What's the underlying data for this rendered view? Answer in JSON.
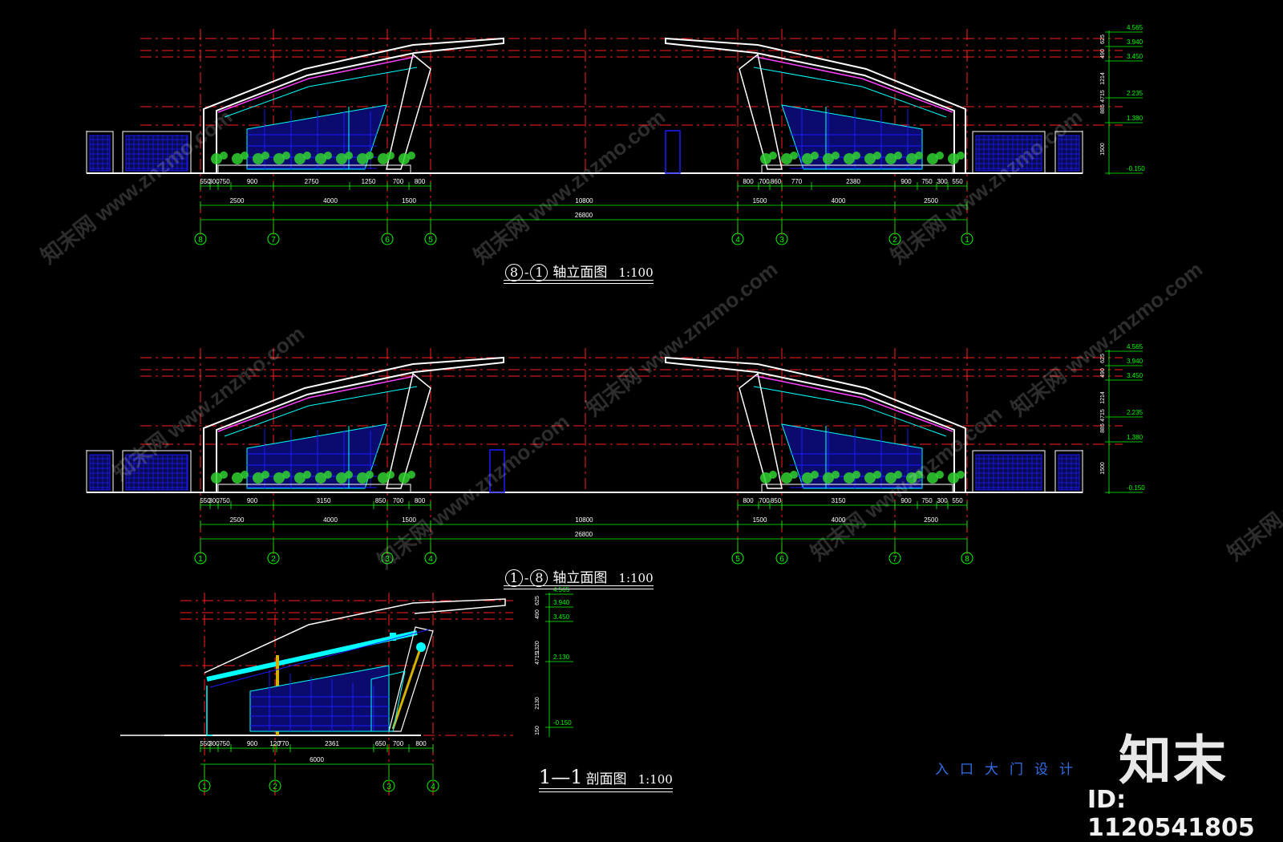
{
  "drawing": {
    "elev1": {
      "title_from": "8",
      "title_sep": "-",
      "title_to": "1",
      "title_name": "轴立面图",
      "scale": "1:100",
      "dims_row1_left": [
        "550",
        "300",
        "750",
        "900",
        "2750",
        "1250",
        "700",
        "800"
      ],
      "dims_row1_right": [
        "800",
        "700",
        "860",
        "770",
        "2380",
        "900",
        "750",
        "300",
        "550"
      ],
      "dims_row2": [
        "2500",
        "4000",
        "1500",
        "10800",
        "1500",
        "4000",
        "2500"
      ],
      "dims_total": "26800",
      "axes": [
        "8",
        "7",
        "6",
        "5",
        "4",
        "3",
        "2",
        "1"
      ],
      "levels": [
        "4.565",
        "3.940",
        "3.450",
        "2.235",
        "1.380",
        "-0.150"
      ],
      "vdims": [
        "625",
        "490",
        "1214",
        "4715",
        "885",
        "1500"
      ]
    },
    "elev2": {
      "title_from": "1",
      "title_sep": "-",
      "title_to": "8",
      "title_name": "轴立面图",
      "scale": "1:100",
      "dims_row1_left": [
        "550",
        "300",
        "750",
        "900",
        "3150",
        "850",
        "700",
        "800"
      ],
      "dims_row1_right": [
        "800",
        "700",
        "850",
        "3150",
        "900",
        "750",
        "300",
        "550"
      ],
      "dims_row2": [
        "2500",
        "4000",
        "1500",
        "10800",
        "1500",
        "4000",
        "2500"
      ],
      "dims_total": "26800",
      "axes": [
        "1",
        "2",
        "3",
        "4",
        "5",
        "6",
        "7",
        "8"
      ],
      "levels": [
        "4.565",
        "3.940",
        "3.450",
        "2.235",
        "1.380",
        "-0.150"
      ],
      "vdims": [
        "625",
        "490",
        "1214",
        "4715",
        "885",
        "1500"
      ]
    },
    "section": {
      "title_from": "1",
      "title_sep": "—",
      "title_to": "1",
      "title_name": "剖面图",
      "scale": "1:100",
      "dims_row1": [
        "550",
        "300",
        "750",
        "900",
        "120",
        "770",
        "2361",
        "650",
        "700",
        "800"
      ],
      "dims_total": "6000",
      "axes": [
        "1",
        "2",
        "3",
        "4"
      ],
      "levels": [
        "4.565",
        "3.940",
        "3.450",
        "2.130",
        "-0.150"
      ],
      "vdims": [
        "625",
        "490",
        "1320",
        "4715",
        "2130",
        "150"
      ]
    },
    "project_title": "入口大门设计",
    "colors": {
      "axis": "#ff2020",
      "structure": "#ffffff",
      "accent": "#ff40ff",
      "glass": "#1a1aff",
      "plants": "#30d030",
      "dims": "#00ff00",
      "cyan": "#00ffff",
      "column": "#d4b000"
    }
  },
  "watermark": {
    "text": "知末网 www.znzmo.com"
  },
  "brand": {
    "logo": "知末",
    "id": "ID: 1120541805"
  }
}
